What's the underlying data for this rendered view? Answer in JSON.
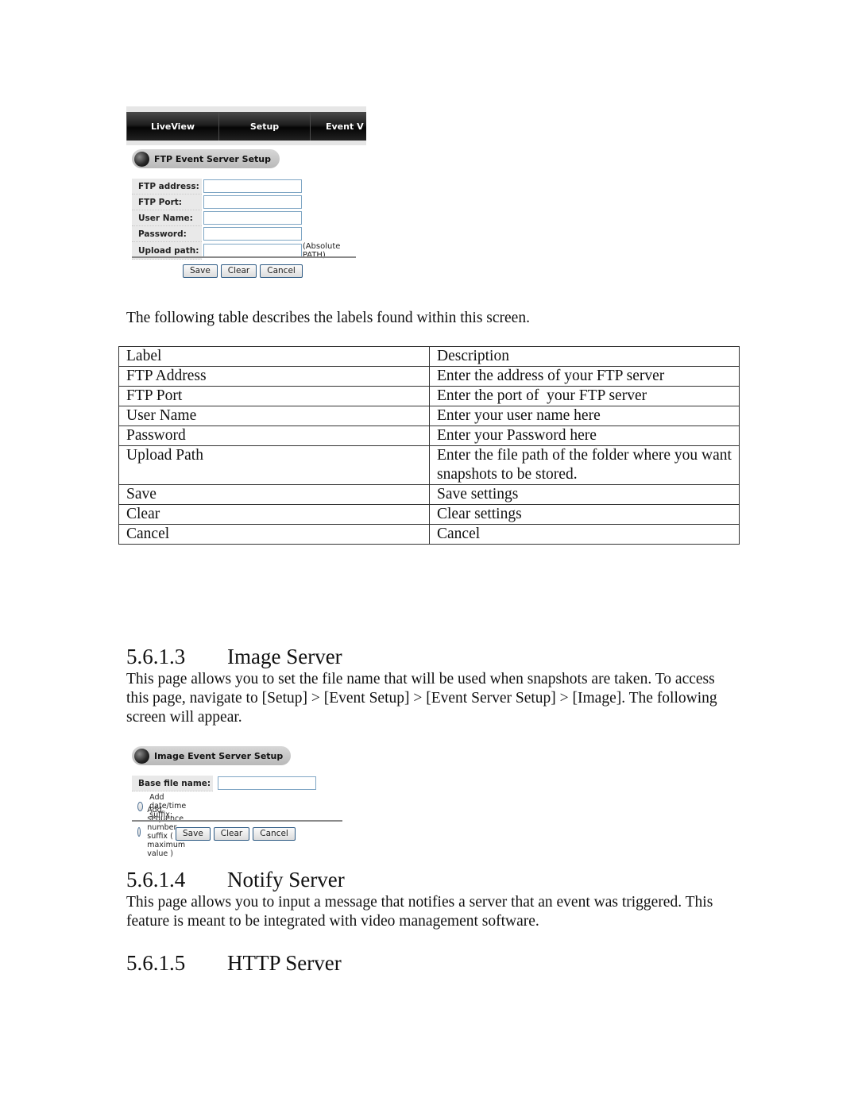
{
  "ftp_screen": {
    "nav_tabs": [
      "LiveView",
      "Setup",
      "Event V"
    ],
    "section_title": "FTP Event Server Setup",
    "fields": [
      {
        "label": "FTP address:",
        "value": ""
      },
      {
        "label": "FTP Port:",
        "value": ""
      },
      {
        "label": "User Name:",
        "value": ""
      },
      {
        "label": "Password:",
        "value": ""
      },
      {
        "label": "Upload path:",
        "value": "",
        "hint": "(Absolute PATH)"
      }
    ],
    "buttons": {
      "save": "Save",
      "clear": "Clear",
      "cancel": "Cancel"
    }
  },
  "intro_text": "The following table describes the labels found within this screen.",
  "table": {
    "header": {
      "label": "Label",
      "description": "Description"
    },
    "rows": [
      {
        "label": "FTP Address",
        "description": "Enter the address of your FTP server"
      },
      {
        "label": "FTP Port",
        "description": "Enter the port of  your FTP server"
      },
      {
        "label": "User Name",
        "description": "Enter your user name here"
      },
      {
        "label": "Password",
        "description": "Enter your Password here"
      },
      {
        "label": "Upload Path",
        "description": "Enter the file path of the folder where you want snapshots to be stored."
      },
      {
        "label": "Save",
        "description": "Save settings"
      },
      {
        "label": "Clear",
        "description": "Clear settings"
      },
      {
        "label": "Cancel",
        "description": "Cancel"
      }
    ]
  },
  "sections": [
    {
      "number": "5.6.1.3",
      "title": "Image Server",
      "body": "This page allows you to set the file name that will be used when snapshots are taken. To access this page, navigate to [Setup] > [Event Setup] > [Event Server Setup] > [Image]. The following screen will appear."
    },
    {
      "number": "5.6.1.4",
      "title": "Notify Server",
      "body": "This page allows you to input a message that notifies a server that an event was triggered. This feature is meant to be integrated with video management software."
    },
    {
      "number": "5.6.1.5",
      "title": "HTTP Server",
      "body": ""
    }
  ],
  "image_screen": {
    "section_title": "Image Event Server Setup",
    "base_file_label": "Base file name:",
    "base_file_value": "",
    "options": [
      {
        "label": "Add date/time suffix:",
        "selected": false
      },
      {
        "label": "Add sequence number suffix ( no maximum value )",
        "selected": false
      }
    ],
    "buttons": {
      "save": "Save",
      "clear": "Clear",
      "cancel": "Cancel"
    }
  }
}
